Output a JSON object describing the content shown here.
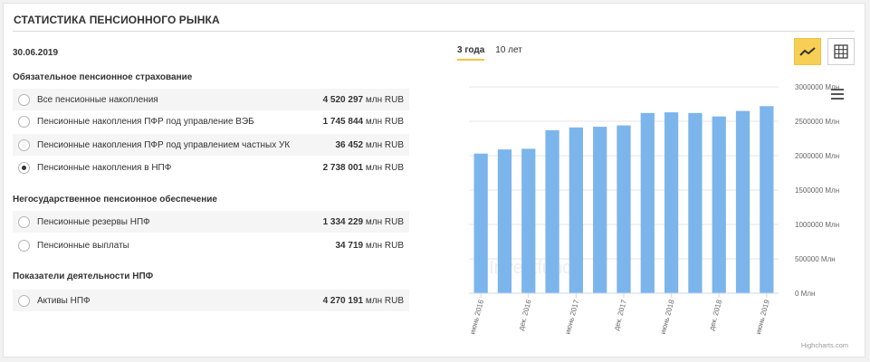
{
  "header": {
    "title": "СТАТИСТИКА ПЕНСИОННОГО РЫНКА"
  },
  "date": "30.06.2019",
  "groups": [
    {
      "title": "Обязательное пенсионное страхование",
      "rows": [
        {
          "label": "Все пенсионные накопления",
          "value": "4 520 297",
          "unit": "млн RUB",
          "checked": false
        },
        {
          "label": "Пенсионные накопления ПФР под управление ВЭБ",
          "value": "1 745 844",
          "unit": "млн RUB",
          "checked": false
        },
        {
          "label": "Пенсионные накопления ПФР под управлением частных УК",
          "value": "36 452",
          "unit": "млн RUB",
          "checked": false
        },
        {
          "label": "Пенсионные накопления в НПФ",
          "value": "2 738 001",
          "unit": "млн RUB",
          "checked": true
        }
      ]
    },
    {
      "title": "Негосударственное пенсионное обеспечение",
      "rows": [
        {
          "label": "Пенсионные резервы НПФ",
          "value": "1 334 229",
          "unit": "млн RUB",
          "checked": false
        },
        {
          "label": "Пенсионные выплаты",
          "value": "34 719",
          "unit": "млн RUB",
          "checked": false
        }
      ]
    },
    {
      "title": "Показатели деятельности НПФ",
      "rows": [
        {
          "label": "Активы НПФ",
          "value": "4 270 191",
          "unit": "млн RUB",
          "checked": false
        }
      ]
    }
  ],
  "tabs": [
    {
      "label": "3 года",
      "active": true
    },
    {
      "label": "10 лет",
      "active": false
    }
  ],
  "icons": {
    "line_view": "line-chart-icon",
    "table_view": "table-grid-icon",
    "menu": "hamburger-menu-icon"
  },
  "colors": {
    "bar": "#7cb5ec",
    "accent": "#f7cf55"
  },
  "chart_data": {
    "type": "bar",
    "categories": [
      "июнь 2016",
      "",
      "дек. 2016",
      "",
      "июнь 2017",
      "",
      "дек. 2017",
      "",
      "июнь 2018",
      "",
      "дек. 2018",
      "",
      "июнь 2019"
    ],
    "values": [
      2030000,
      2090000,
      2100000,
      2370000,
      2410000,
      2420000,
      2440000,
      2620000,
      2630000,
      2620000,
      2570000,
      2650000,
      2720000
    ],
    "yticks": [
      "0 Млн",
      "500000 Млн",
      "1000000 Млн",
      "1500000 Млн",
      "2000000 Млн",
      "2500000 Млн",
      "3000000 Млн"
    ],
    "ylim": [
      0,
      3000000
    ],
    "credits": "Highcharts.com",
    "watermark": "Investfunds"
  }
}
